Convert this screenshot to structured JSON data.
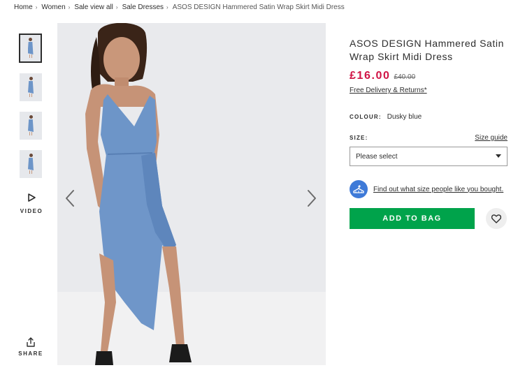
{
  "breadcrumb": {
    "items": [
      {
        "label": "Home"
      },
      {
        "label": "Women"
      },
      {
        "label": "Sale view all"
      },
      {
        "label": "Sale Dresses"
      }
    ],
    "separator": "›",
    "current": "ASOS DESIGN Hammered Satin Wrap Skirt Midi Dress"
  },
  "gallery": {
    "video_label": "VIDEO",
    "share_label": "SHARE"
  },
  "product": {
    "title": "ASOS DESIGN Hammered Satin Wrap Skirt Midi Dress",
    "price_now": "£16.00",
    "price_was": "£40.00",
    "delivery_link": "Free Delivery & Returns*",
    "colour_label": "COLOUR:",
    "colour_value": "Dusky blue",
    "size_label": "SIZE:",
    "size_guide": "Size guide",
    "size_select": "Please select",
    "fit_link": "Find out what size people like you bought.",
    "add_to_bag": "ADD TO BAG"
  },
  "colors": {
    "price": "#d01345",
    "add_to_bag": "#00a34b",
    "fit_icon": "#3e7ad8",
    "dress": "#6d95c8"
  },
  "icons": {
    "prev": "chevron-left-icon",
    "next": "chevron-right-icon",
    "video": "play-icon",
    "share": "share-icon",
    "fit": "hanger-icon",
    "save": "heart-icon",
    "select": "chevron-down-icon"
  }
}
